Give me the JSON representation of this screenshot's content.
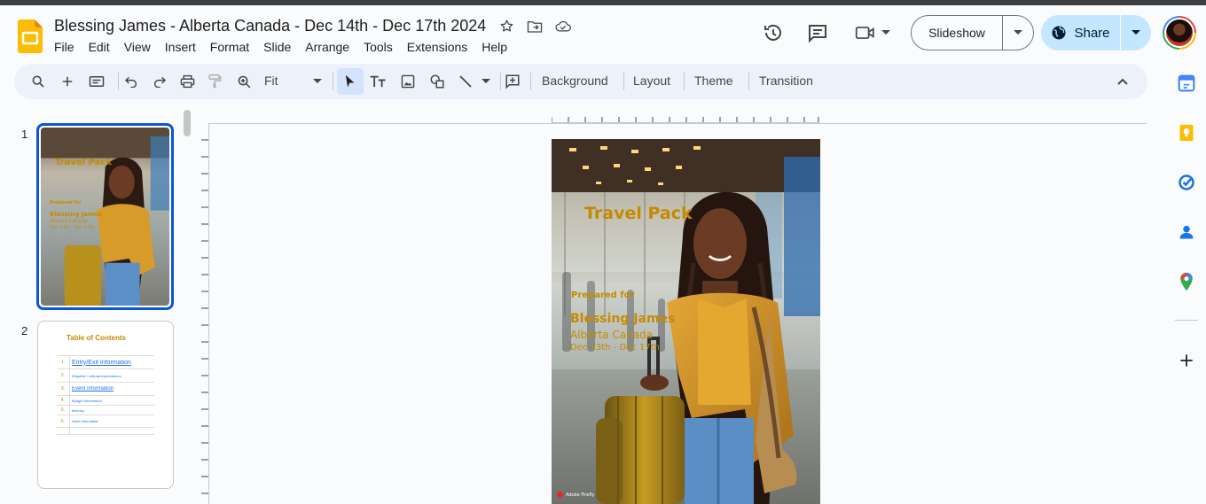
{
  "header": {
    "title": "Blessing James - Alberta Canada - Dec 14th - Dec 17th 2024",
    "menu": [
      "File",
      "Edit",
      "View",
      "Insert",
      "Format",
      "Slide",
      "Arrange",
      "Tools",
      "Extensions",
      "Help"
    ],
    "slideshow_label": "Slideshow",
    "share_label": "Share"
  },
  "toolbar": {
    "zoom_value": "Fit",
    "background_label": "Background",
    "layout_label": "Layout",
    "theme_label": "Theme",
    "transition_label": "Transition"
  },
  "filmstrip": {
    "slide1_number": "1",
    "slide2_number": "2",
    "thumb1": {
      "title": "Travel Pack",
      "prepared": "Prepared for",
      "name": "Blessing James",
      "place": "Alberta Canada",
      "dates": "Dec 13th - Dec 17th"
    },
    "thumb2": {
      "title": "Table of Contents",
      "rows": [
        {
          "num": "1.",
          "text": "Entry/Exit Information"
        },
        {
          "num": "2.",
          "text": "Etiquette / cultural expectations"
        },
        {
          "num": "3.",
          "text": "Event Information"
        },
        {
          "num": "4.",
          "text": "Budget Information"
        },
        {
          "num": "5.",
          "text": "Itinerary"
        },
        {
          "num": "6.",
          "text": "Hotel Information"
        },
        {
          "num": "",
          "text": ""
        }
      ]
    }
  },
  "slide": {
    "title": "Travel Pack",
    "prepared": "Prepared for",
    "name": "Blessing James",
    "place": "Alberta Canada",
    "dates": "Dec 13th - Dec 17th",
    "watermark": "Adobe Firefly"
  },
  "colors": {
    "accent_gold": "#c58a00",
    "share_bg": "#c2e7ff",
    "selection_blue": "#0b57d0"
  },
  "icons": {
    "app_logo": "slides-logo-icon",
    "star": "star-icon",
    "move": "move-to-folder-icon",
    "cloud": "cloud-saved-icon",
    "history": "version-history-icon",
    "comments": "comments-icon",
    "meet": "meet-camera-icon"
  }
}
